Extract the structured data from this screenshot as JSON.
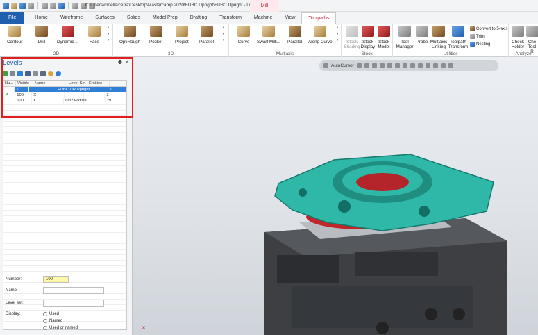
{
  "titlebar": {
    "path": "C:\\Users\\mdellaicerra\\Desktop\\Mastercamp 2020\\FUBC Upright\\FUBC Upright - Demos\\F...",
    "context_tab": "Mill"
  },
  "tabs": [
    "File",
    "Home",
    "Wireframe",
    "Surfaces",
    "Solids",
    "Model Prep",
    "Drafting",
    "Transform",
    "Machine",
    "View",
    "Toolpaths"
  ],
  "ribbon": {
    "groups": {
      "g2d": "2D",
      "g3d": "3D",
      "multiaxis": "Multiaxis",
      "stock": "Stock",
      "utilities": "Utilities",
      "analyze": "Analyze"
    },
    "buttons": {
      "contour": "Contour",
      "drill": "Drill",
      "dynamic": "Dynamic ...",
      "face": "Face",
      "optirough": "OptiRough",
      "pocket": "Pocket",
      "project": "Project",
      "parallel3d": "Parallel",
      "curve": "Curve",
      "swarf": "Swarf Milli...",
      "parallel_ma": "Parallel",
      "along_curve": "Along Curve",
      "stock_shading": "Stock Shading",
      "stock_display": "Stock Display",
      "stock_model": "Stock Model",
      "tool_manager": "Tool Manager",
      "probe": "Probe",
      "multiaxis_linking": "Multiaxis Linking",
      "toolpath_transform": "Toolpath Transform",
      "check_holder": "Check Holder",
      "check_tool_reach": "Che Tool R"
    },
    "small": {
      "convert": "Convert to 5-axis",
      "trim": "Trim",
      "nesting": "Nesting"
    }
  },
  "levels_panel": {
    "title": "Levels",
    "pin": "⚉",
    "close": "×",
    "columns": [
      "Nu...",
      "Visible",
      "Name",
      "Level Set",
      "Entities"
    ],
    "rows": [
      {
        "check": "",
        "number": "1",
        "visible": "",
        "name": "FUBC UR Upright",
        "level_set": "",
        "entities": "1",
        "selected": true
      },
      {
        "check": "✔",
        "number": "100",
        "visible": "X",
        "name": "",
        "level_set": "",
        "entities": "3",
        "selected": false
      },
      {
        "check": "",
        "number": "600",
        "visible": "X",
        "name": "Op2 Fixture",
        "level_set": "",
        "entities": "29",
        "selected": false
      }
    ],
    "props": {
      "number_label": "Number:",
      "number_value": "100",
      "name_label": "Name:",
      "name_value": "",
      "levelset_label": "Level set:",
      "levelset_value": "",
      "display_label": "Display:",
      "options": [
        "Used",
        "Named",
        "Used or named"
      ]
    }
  },
  "viewport": {
    "autocursor": "AutoCursor"
  },
  "colors": {
    "accent": "#1f5fae",
    "highlight": "#e0201f",
    "part": "#2fb8a8"
  }
}
